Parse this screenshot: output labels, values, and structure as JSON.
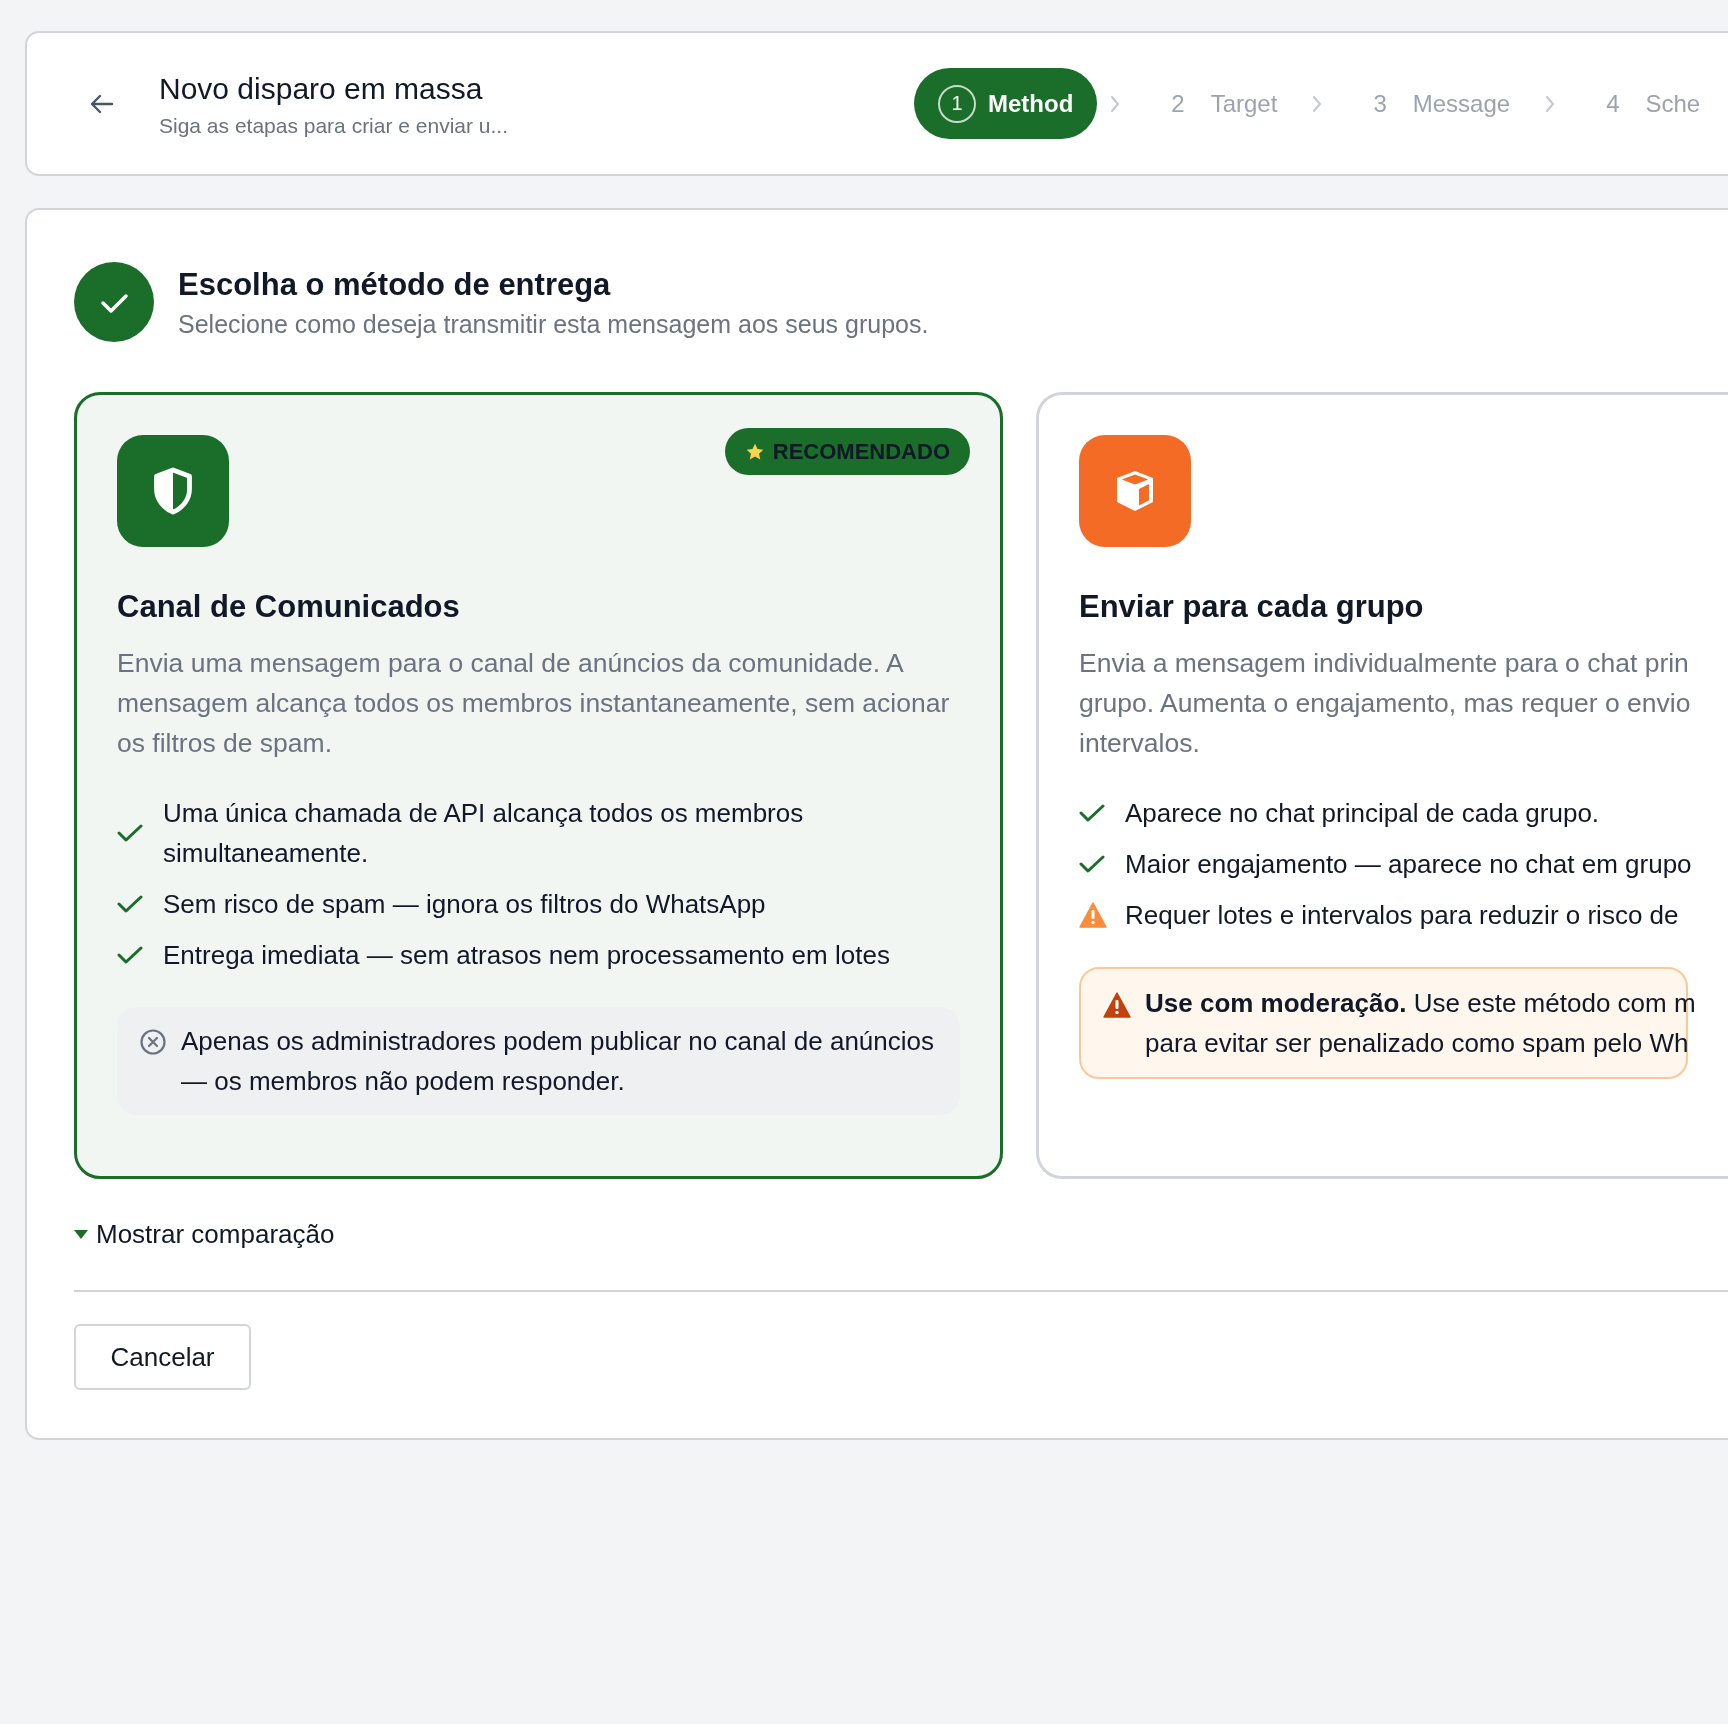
{
  "header": {
    "title": "Novo disparo em massa",
    "subtitle": "Siga as etapas para criar e enviar u...",
    "steps": [
      {
        "number": "1",
        "label": "Method",
        "selected": true
      },
      {
        "number": "2",
        "label": "Target",
        "selected": false
      },
      {
        "number": "3",
        "label": "Message",
        "selected": false
      },
      {
        "number": "4",
        "label": "Sche",
        "selected": false
      }
    ]
  },
  "section": {
    "title": "Escolha o método de entrega",
    "subtitle": "Selecione como deseja transmitir esta mensagem aos seus grupos."
  },
  "methods": [
    {
      "kind": "channel",
      "color": "#1a6e2a",
      "selected": true,
      "badge": "RECOMENDADO",
      "title": "Canal de Comunicados",
      "description": [
        "Envia uma mensagem para o canal de anúncios da comunidade. A mensagem alcança todos os membros instantaneamente, sem acionar os filtros de spam."
      ],
      "features": [
        {
          "kind": "check",
          "text": "Uma única chamada de API alcança todos os membros simultaneamente."
        },
        {
          "kind": "check",
          "text": "Sem risco de spam — ignora os filtros do WhatsApp"
        },
        {
          "kind": "check",
          "text": "Entrega imediata — sem atrasos nem processamento em lotes"
        }
      ],
      "note": {
        "kind": "info",
        "lines": [
          "Apenas os administradores podem publicar no canal de anúncios — os membros não podem responder."
        ]
      }
    },
    {
      "kind": "groups",
      "color": "#f46b25",
      "selected": false,
      "title": "Enviar para cada grupo",
      "description": [
        "Envia a mensagem individualmente para o chat prin",
        "grupo. Aumenta o engajamento, mas requer o envio",
        "intervalos."
      ],
      "features": [
        {
          "kind": "check",
          "text": "Aparece no chat principal de cada grupo."
        },
        {
          "kind": "check",
          "text": "Maior engajamento — aparece no chat em grupo"
        },
        {
          "kind": "warning",
          "text": "Requer lotes e intervalos para reduzir o risco de"
        }
      ],
      "note": {
        "kind": "warning",
        "lines": [
          "**Use com moderação.** Use este método com m",
          "para evitar ser penalizado como spam pelo Wh"
        ]
      }
    }
  ],
  "comparison_toggle": {
    "label": "Mostrar comparação"
  },
  "buttons": [
    {
      "label": "Cancelar"
    }
  ]
}
